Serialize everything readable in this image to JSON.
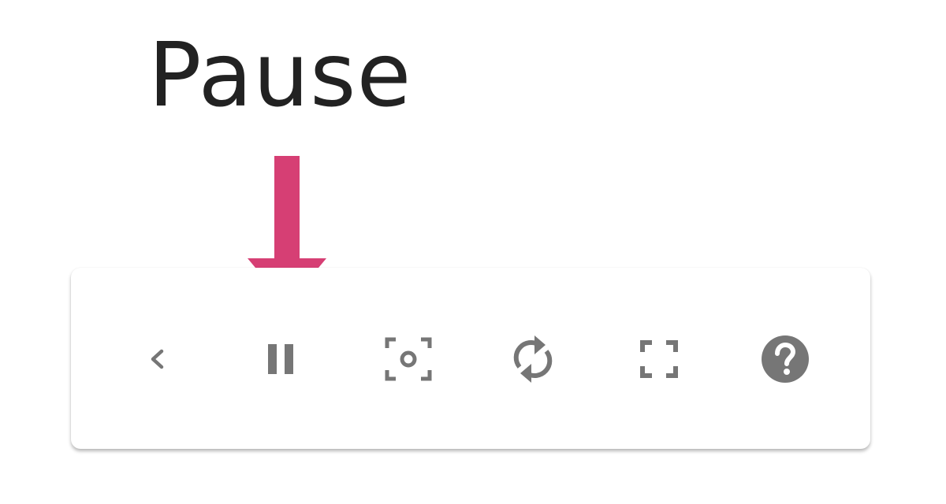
{
  "callout": {
    "label": "Pause",
    "arrow_color": "#d63f74",
    "label_color": "#222222"
  },
  "toolbar": {
    "icon_color": "#767676",
    "buttons": [
      {
        "name": "back-button",
        "icon": "chevron-left-icon"
      },
      {
        "name": "pause-button",
        "icon": "pause-icon"
      },
      {
        "name": "screenshot-button",
        "icon": "camera-frame-icon"
      },
      {
        "name": "rotate-button",
        "icon": "sync-icon"
      },
      {
        "name": "fullscreen-button",
        "icon": "fullscreen-icon"
      },
      {
        "name": "help-button",
        "icon": "help-circle-icon"
      }
    ]
  }
}
